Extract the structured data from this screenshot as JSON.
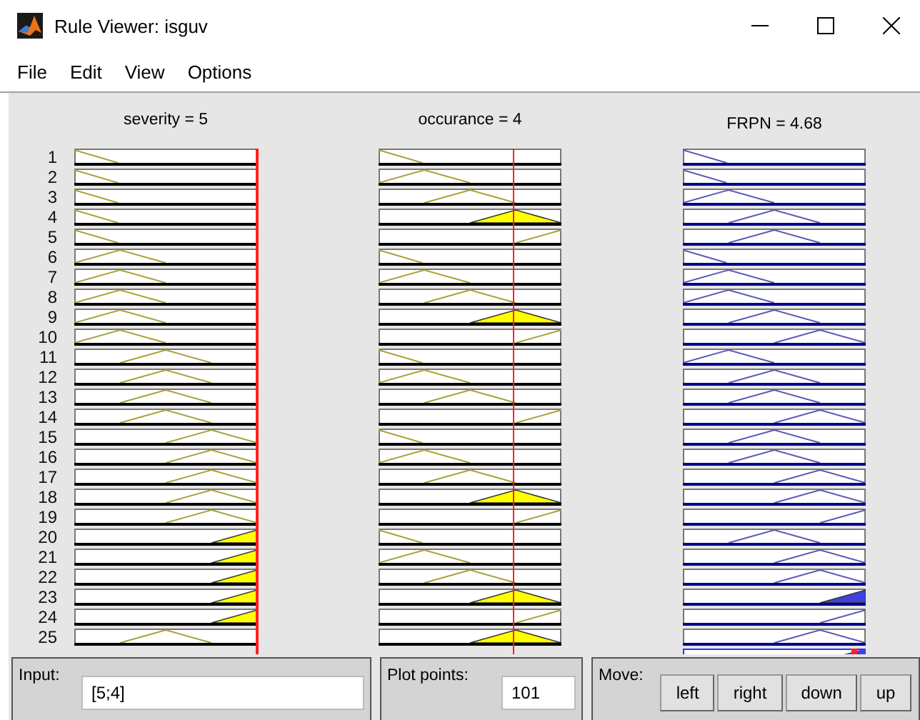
{
  "window": {
    "title": "Rule Viewer: isguv"
  },
  "menu": [
    "File",
    "Edit",
    "View",
    "Options"
  ],
  "inputs": [
    {
      "label": "severity = 5"
    },
    {
      "label": "occurance = 4"
    }
  ],
  "output": {
    "label": "FRPN = 4.68"
  },
  "rules": [
    {
      "number": "1",
      "cells": [
        {
          "kind": "falling",
          "fired": false
        },
        {
          "kind": "falling",
          "fired": false
        },
        {
          "kind": "falling",
          "fired": false
        }
      ]
    },
    {
      "number": "2",
      "cells": [
        {
          "kind": "falling",
          "fired": false
        },
        {
          "kind": "low",
          "fired": false
        },
        {
          "kind": "falling",
          "fired": false
        }
      ]
    },
    {
      "number": "3",
      "cells": [
        {
          "kind": "falling",
          "fired": false
        },
        {
          "kind": "middle",
          "fired": false
        },
        {
          "kind": "low",
          "fired": false
        }
      ]
    },
    {
      "number": "4",
      "cells": [
        {
          "kind": "falling",
          "fired": false
        },
        {
          "kind": "high",
          "fired": true
        },
        {
          "kind": "middle",
          "fired": false
        }
      ]
    },
    {
      "number": "5",
      "cells": [
        {
          "kind": "falling",
          "fired": false
        },
        {
          "kind": "rising",
          "fired": false
        },
        {
          "kind": "middle",
          "fired": false
        }
      ]
    },
    {
      "number": "6",
      "cells": [
        {
          "kind": "low",
          "fired": false
        },
        {
          "kind": "falling",
          "fired": false
        },
        {
          "kind": "falling",
          "fired": false
        }
      ]
    },
    {
      "number": "7",
      "cells": [
        {
          "kind": "low",
          "fired": false
        },
        {
          "kind": "low",
          "fired": false
        },
        {
          "kind": "low",
          "fired": false
        }
      ]
    },
    {
      "number": "8",
      "cells": [
        {
          "kind": "low",
          "fired": false
        },
        {
          "kind": "middle",
          "fired": false
        },
        {
          "kind": "low",
          "fired": false
        }
      ]
    },
    {
      "number": "9",
      "cells": [
        {
          "kind": "low",
          "fired": false
        },
        {
          "kind": "high",
          "fired": true
        },
        {
          "kind": "middle",
          "fired": false
        }
      ]
    },
    {
      "number": "10",
      "cells": [
        {
          "kind": "low",
          "fired": false
        },
        {
          "kind": "rising",
          "fired": false
        },
        {
          "kind": "high",
          "fired": false
        }
      ]
    },
    {
      "number": "11",
      "cells": [
        {
          "kind": "middle",
          "fired": false
        },
        {
          "kind": "falling",
          "fired": false
        },
        {
          "kind": "low",
          "fired": false
        }
      ]
    },
    {
      "number": "12",
      "cells": [
        {
          "kind": "middle",
          "fired": false
        },
        {
          "kind": "low",
          "fired": false
        },
        {
          "kind": "middle",
          "fired": false
        }
      ]
    },
    {
      "number": "13",
      "cells": [
        {
          "kind": "middle",
          "fired": false
        },
        {
          "kind": "middle",
          "fired": false
        },
        {
          "kind": "middle",
          "fired": false
        }
      ]
    },
    {
      "number": "14",
      "cells": [
        {
          "kind": "middle",
          "fired": false
        },
        {
          "kind": "rising",
          "fired": false
        },
        {
          "kind": "high",
          "fired": false
        }
      ]
    },
    {
      "number": "15",
      "cells": [
        {
          "kind": "high",
          "fired": false
        },
        {
          "kind": "falling",
          "fired": false
        },
        {
          "kind": "middle",
          "fired": false
        }
      ]
    },
    {
      "number": "16",
      "cells": [
        {
          "kind": "high",
          "fired": false
        },
        {
          "kind": "low",
          "fired": false
        },
        {
          "kind": "middle",
          "fired": false
        }
      ]
    },
    {
      "number": "17",
      "cells": [
        {
          "kind": "high",
          "fired": false
        },
        {
          "kind": "middle",
          "fired": false
        },
        {
          "kind": "high",
          "fired": false
        }
      ]
    },
    {
      "number": "18",
      "cells": [
        {
          "kind": "high",
          "fired": false
        },
        {
          "kind": "high",
          "fired": true
        },
        {
          "kind": "high",
          "fired": false
        }
      ]
    },
    {
      "number": "19",
      "cells": [
        {
          "kind": "high",
          "fired": false
        },
        {
          "kind": "rising",
          "fired": false
        },
        {
          "kind": "rising",
          "fired": false
        }
      ]
    },
    {
      "number": "20",
      "cells": [
        {
          "kind": "rising",
          "fired": true
        },
        {
          "kind": "falling",
          "fired": false
        },
        {
          "kind": "middle",
          "fired": false
        }
      ]
    },
    {
      "number": "21",
      "cells": [
        {
          "kind": "rising",
          "fired": true
        },
        {
          "kind": "low",
          "fired": false
        },
        {
          "kind": "high",
          "fired": false
        }
      ]
    },
    {
      "number": "22",
      "cells": [
        {
          "kind": "rising",
          "fired": true
        },
        {
          "kind": "middle",
          "fired": false
        },
        {
          "kind": "high",
          "fired": false
        }
      ]
    },
    {
      "number": "23",
      "cells": [
        {
          "kind": "rising",
          "fired": true
        },
        {
          "kind": "high",
          "fired": true
        },
        {
          "kind": "rising",
          "fired": true
        }
      ]
    },
    {
      "number": "24",
      "cells": [
        {
          "kind": "rising",
          "fired": true
        },
        {
          "kind": "rising",
          "fired": false
        },
        {
          "kind": "rising",
          "fired": false
        }
      ]
    },
    {
      "number": "25",
      "cells": [
        {
          "kind": "middle",
          "fired": false
        },
        {
          "kind": "high",
          "fired": true
        },
        {
          "kind": "high",
          "fired": false
        }
      ]
    }
  ],
  "input_field": {
    "label": "Input:",
    "value": "[5;4]"
  },
  "plot_points": {
    "label": "Plot points:",
    "value": "101"
  },
  "move": {
    "label": "Move:",
    "buttons": [
      "left",
      "right",
      "down",
      "up"
    ]
  }
}
